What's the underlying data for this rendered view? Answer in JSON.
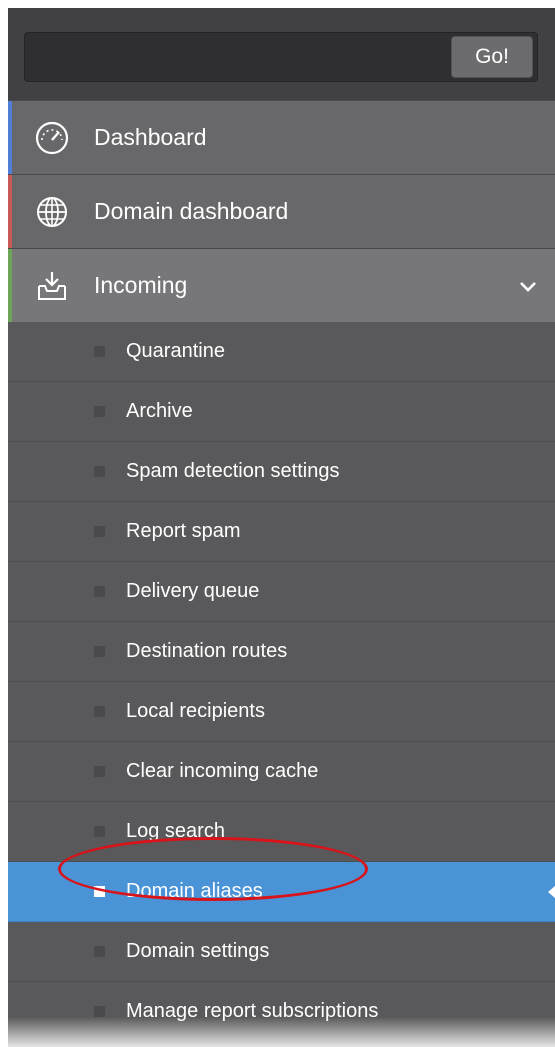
{
  "search": {
    "placeholder": "",
    "go_label": "Go!"
  },
  "nav": {
    "items": [
      {
        "label": "Dashboard",
        "icon": "speedometer-icon",
        "accent": "#4f7fd6"
      },
      {
        "label": "Domain dashboard",
        "icon": "globe-icon",
        "accent": "#c85a5a"
      },
      {
        "label": "Incoming",
        "icon": "inbox-download-icon",
        "accent": "#6ea35a",
        "expanded": true
      }
    ],
    "incoming_subitems": [
      {
        "label": "Quarantine"
      },
      {
        "label": "Archive"
      },
      {
        "label": "Spam detection settings"
      },
      {
        "label": "Report spam"
      },
      {
        "label": "Delivery queue"
      },
      {
        "label": "Destination routes"
      },
      {
        "label": "Local recipients"
      },
      {
        "label": "Clear incoming cache"
      },
      {
        "label": "Log search"
      },
      {
        "label": "Domain aliases",
        "active": true
      },
      {
        "label": "Domain settings"
      },
      {
        "label": "Manage report subscriptions"
      }
    ]
  },
  "colors": {
    "active": "#4a93d6",
    "panel": "#59595b",
    "highlight_ring": "#d8141a"
  }
}
